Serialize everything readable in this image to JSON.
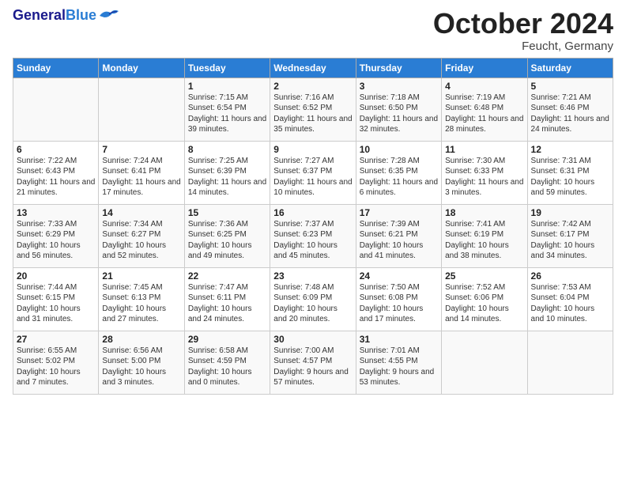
{
  "header": {
    "logo_general": "General",
    "logo_blue": "Blue",
    "month": "October 2024",
    "location": "Feucht, Germany"
  },
  "weekdays": [
    "Sunday",
    "Monday",
    "Tuesday",
    "Wednesday",
    "Thursday",
    "Friday",
    "Saturday"
  ],
  "rows": [
    [
      {
        "day": "",
        "info": ""
      },
      {
        "day": "",
        "info": ""
      },
      {
        "day": "1",
        "info": "Sunrise: 7:15 AM\nSunset: 6:54 PM\nDaylight: 11 hours and 39 minutes."
      },
      {
        "day": "2",
        "info": "Sunrise: 7:16 AM\nSunset: 6:52 PM\nDaylight: 11 hours and 35 minutes."
      },
      {
        "day": "3",
        "info": "Sunrise: 7:18 AM\nSunset: 6:50 PM\nDaylight: 11 hours and 32 minutes."
      },
      {
        "day": "4",
        "info": "Sunrise: 7:19 AM\nSunset: 6:48 PM\nDaylight: 11 hours and 28 minutes."
      },
      {
        "day": "5",
        "info": "Sunrise: 7:21 AM\nSunset: 6:46 PM\nDaylight: 11 hours and 24 minutes."
      }
    ],
    [
      {
        "day": "6",
        "info": "Sunrise: 7:22 AM\nSunset: 6:43 PM\nDaylight: 11 hours and 21 minutes."
      },
      {
        "day": "7",
        "info": "Sunrise: 7:24 AM\nSunset: 6:41 PM\nDaylight: 11 hours and 17 minutes."
      },
      {
        "day": "8",
        "info": "Sunrise: 7:25 AM\nSunset: 6:39 PM\nDaylight: 11 hours and 14 minutes."
      },
      {
        "day": "9",
        "info": "Sunrise: 7:27 AM\nSunset: 6:37 PM\nDaylight: 11 hours and 10 minutes."
      },
      {
        "day": "10",
        "info": "Sunrise: 7:28 AM\nSunset: 6:35 PM\nDaylight: 11 hours and 6 minutes."
      },
      {
        "day": "11",
        "info": "Sunrise: 7:30 AM\nSunset: 6:33 PM\nDaylight: 11 hours and 3 minutes."
      },
      {
        "day": "12",
        "info": "Sunrise: 7:31 AM\nSunset: 6:31 PM\nDaylight: 10 hours and 59 minutes."
      }
    ],
    [
      {
        "day": "13",
        "info": "Sunrise: 7:33 AM\nSunset: 6:29 PM\nDaylight: 10 hours and 56 minutes."
      },
      {
        "day": "14",
        "info": "Sunrise: 7:34 AM\nSunset: 6:27 PM\nDaylight: 10 hours and 52 minutes."
      },
      {
        "day": "15",
        "info": "Sunrise: 7:36 AM\nSunset: 6:25 PM\nDaylight: 10 hours and 49 minutes."
      },
      {
        "day": "16",
        "info": "Sunrise: 7:37 AM\nSunset: 6:23 PM\nDaylight: 10 hours and 45 minutes."
      },
      {
        "day": "17",
        "info": "Sunrise: 7:39 AM\nSunset: 6:21 PM\nDaylight: 10 hours and 41 minutes."
      },
      {
        "day": "18",
        "info": "Sunrise: 7:41 AM\nSunset: 6:19 PM\nDaylight: 10 hours and 38 minutes."
      },
      {
        "day": "19",
        "info": "Sunrise: 7:42 AM\nSunset: 6:17 PM\nDaylight: 10 hours and 34 minutes."
      }
    ],
    [
      {
        "day": "20",
        "info": "Sunrise: 7:44 AM\nSunset: 6:15 PM\nDaylight: 10 hours and 31 minutes."
      },
      {
        "day": "21",
        "info": "Sunrise: 7:45 AM\nSunset: 6:13 PM\nDaylight: 10 hours and 27 minutes."
      },
      {
        "day": "22",
        "info": "Sunrise: 7:47 AM\nSunset: 6:11 PM\nDaylight: 10 hours and 24 minutes."
      },
      {
        "day": "23",
        "info": "Sunrise: 7:48 AM\nSunset: 6:09 PM\nDaylight: 10 hours and 20 minutes."
      },
      {
        "day": "24",
        "info": "Sunrise: 7:50 AM\nSunset: 6:08 PM\nDaylight: 10 hours and 17 minutes."
      },
      {
        "day": "25",
        "info": "Sunrise: 7:52 AM\nSunset: 6:06 PM\nDaylight: 10 hours and 14 minutes."
      },
      {
        "day": "26",
        "info": "Sunrise: 7:53 AM\nSunset: 6:04 PM\nDaylight: 10 hours and 10 minutes."
      }
    ],
    [
      {
        "day": "27",
        "info": "Sunrise: 6:55 AM\nSunset: 5:02 PM\nDaylight: 10 hours and 7 minutes."
      },
      {
        "day": "28",
        "info": "Sunrise: 6:56 AM\nSunset: 5:00 PM\nDaylight: 10 hours and 3 minutes."
      },
      {
        "day": "29",
        "info": "Sunrise: 6:58 AM\nSunset: 4:59 PM\nDaylight: 10 hours and 0 minutes."
      },
      {
        "day": "30",
        "info": "Sunrise: 7:00 AM\nSunset: 4:57 PM\nDaylight: 9 hours and 57 minutes."
      },
      {
        "day": "31",
        "info": "Sunrise: 7:01 AM\nSunset: 4:55 PM\nDaylight: 9 hours and 53 minutes."
      },
      {
        "day": "",
        "info": ""
      },
      {
        "day": "",
        "info": ""
      }
    ]
  ]
}
